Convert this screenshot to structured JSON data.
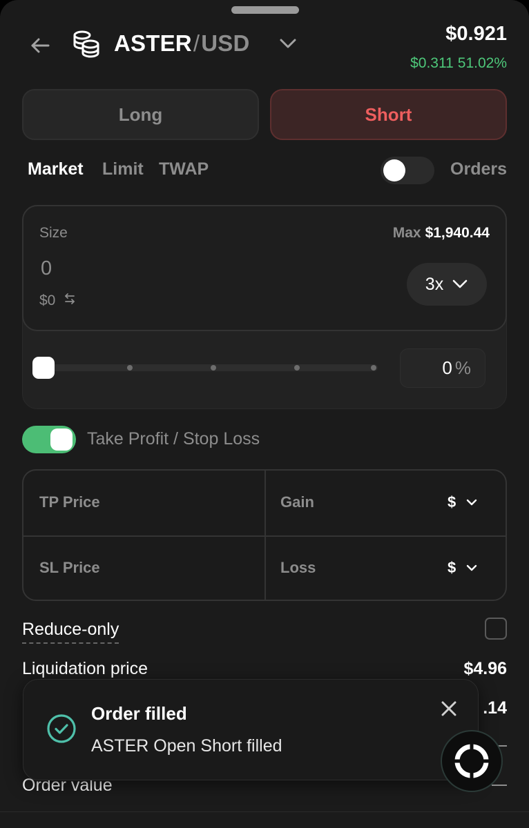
{
  "header": {
    "base": "ASTER",
    "separator": "/",
    "quote": "USD",
    "price": "$0.921",
    "change_abs": "$0.311",
    "change_pct": "51.02%"
  },
  "side": {
    "long_label": "Long",
    "short_label": "Short",
    "selected": "Short"
  },
  "order_types": {
    "market": "Market",
    "limit": "Limit",
    "twap": "TWAP",
    "selected": "Market",
    "orders_label": "Orders",
    "orders_toggle_on": false
  },
  "size": {
    "label": "Size",
    "max_label": "Max",
    "max_value": "$1,940.44",
    "value": "0",
    "usd_value": "$0",
    "swap_icon": "swap-arrows-icon",
    "leverage": "3x",
    "percent_value": "0",
    "percent_suffix": "%",
    "slider_percent": 0
  },
  "tpsl": {
    "label": "Take Profit / Stop Loss",
    "toggle_on": true,
    "tp_price_label": "TP Price",
    "gain_label": "Gain",
    "gain_unit": "$",
    "sl_price_label": "SL Price",
    "loss_label": "Loss",
    "loss_unit": "$"
  },
  "details": {
    "reduce_only_label": "Reduce-only",
    "reduce_only_checked": false,
    "liquidation_label": "Liquidation price",
    "liquidation_value": "$4.96",
    "partial_value": ".14",
    "order_value_label": "Order value"
  },
  "toast": {
    "title": "Order filled",
    "message": "ASTER Open Short filled",
    "icon": "check-circle-icon"
  },
  "colors": {
    "accent_green": "#4cbd75",
    "positive_text": "#4ec87a",
    "short_red": "#ee5e5e",
    "toast_check": "#4fc0aa"
  }
}
